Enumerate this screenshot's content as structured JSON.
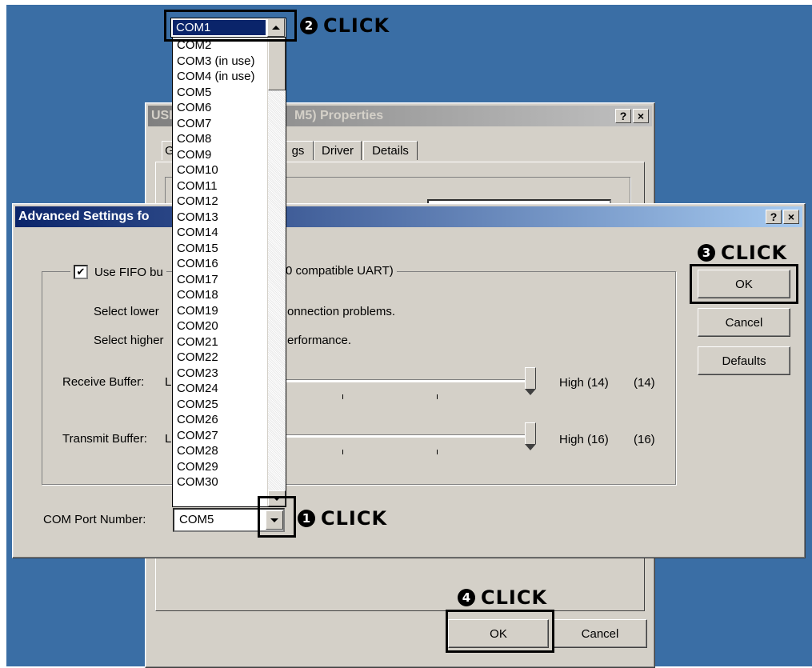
{
  "background_window": {
    "title_visible": "USB Serial Port (COM5) Properties",
    "title_left_fragment": "USI",
    "title_right_fragment": "M5) Properties",
    "help_btn": "?",
    "close_btn": "×",
    "tabs": [
      {
        "label": "G"
      },
      {
        "label": "gs"
      },
      {
        "label": "Driver"
      },
      {
        "label": "Details"
      }
    ],
    "ok_label": "OK",
    "cancel_label": "Cancel"
  },
  "dialog": {
    "title": "Advanced Settings fo",
    "help_btn": "?",
    "close_btn": "×",
    "fifo_checked": true,
    "fifo_label_left": "Use FIFO bu",
    "fifo_label_right": "0 compatible UART)",
    "hint_lower_left": "Select lower",
    "hint_lower_right": "onnection problems.",
    "hint_higher_left": "Select higher",
    "hint_higher_right": "erformance.",
    "receive_label": "Receive Buffer:",
    "receive_low": "L",
    "receive_high": "High (14)",
    "receive_value": "(14)",
    "transmit_label": "Transmit Buffer:",
    "transmit_low": "L",
    "transmit_high": "High (16)",
    "transmit_value": "(16)",
    "ok_label": "OK",
    "cancel_label": "Cancel",
    "defaults_label": "Defaults",
    "com_port_label": "COM Port Number:",
    "com_port_value": "COM5"
  },
  "dropdown": {
    "selected": "COM1",
    "items": [
      "COM2",
      "COM3 (in use)",
      "COM4 (in use)",
      "COM5",
      "COM6",
      "COM7",
      "COM8",
      "COM9",
      "COM10",
      "COM11",
      "COM12",
      "COM13",
      "COM14",
      "COM15",
      "COM16",
      "COM17",
      "COM18",
      "COM19",
      "COM20",
      "COM21",
      "COM22",
      "COM23",
      "COM24",
      "COM25",
      "COM26",
      "COM27",
      "COM28",
      "COM29",
      "COM30"
    ]
  },
  "annotations": {
    "step1": {
      "num": "1",
      "text": "CLICK"
    },
    "step2": {
      "num": "2",
      "text": "CLICK"
    },
    "step3": {
      "num": "3",
      "text": "CLICK"
    },
    "step4": {
      "num": "4",
      "text": "CLICK"
    }
  },
  "colors": {
    "desktop": "#3a6ea5",
    "active_title": "#0a246a",
    "selection": "#0a246a",
    "dialog_face": "#d4d0c8"
  }
}
